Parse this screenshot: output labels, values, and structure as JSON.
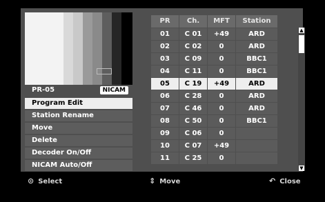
{
  "preview": {
    "bars": [
      "#f3f3f3",
      "#f3f3f3",
      "#d9d9d9",
      "#c9c9c9",
      "#9a9a9a",
      "#8a8a8a",
      "#5e5e5e",
      "#262626",
      "#000000"
    ],
    "program_number": "PR-05",
    "audio_mode": "NICAM"
  },
  "menu": {
    "items": [
      {
        "label": "Program Edit",
        "selected": true
      },
      {
        "label": "Station Rename",
        "selected": false
      },
      {
        "label": "Move",
        "selected": false
      },
      {
        "label": "Delete",
        "selected": false
      },
      {
        "label": "Decoder On/Off",
        "selected": false
      },
      {
        "label": "NICAM Auto/Off",
        "selected": false
      }
    ]
  },
  "table": {
    "headers": [
      "PR",
      "Ch.",
      "MFT",
      "Station"
    ],
    "rows": [
      [
        "01",
        "C 01",
        "+49",
        "ARD"
      ],
      [
        "02",
        "C 02",
        "0",
        "ARD"
      ],
      [
        "03",
        "C 09",
        "0",
        "BBC1"
      ],
      [
        "04",
        "C 11",
        "0",
        "BBC1"
      ],
      [
        "05",
        "C 19",
        "+49",
        "ARD"
      ],
      [
        "06",
        "C 28",
        "0",
        "ARD"
      ],
      [
        "07",
        "C 46",
        "0",
        "ARD"
      ],
      [
        "08",
        "C 50",
        "0",
        "BBC1"
      ],
      [
        "09",
        "C 06",
        "0",
        ""
      ],
      [
        "10",
        "C 07",
        "+49",
        ""
      ],
      [
        "11",
        "C 25",
        "0",
        ""
      ]
    ],
    "selected_row": 4
  },
  "footer": {
    "select": {
      "label": "Select",
      "icon": "circle-select-icon"
    },
    "move": {
      "label": "Move",
      "icon": "up-down-arrows-icon"
    },
    "close": {
      "label": "Close",
      "icon": "return-icon"
    }
  }
}
